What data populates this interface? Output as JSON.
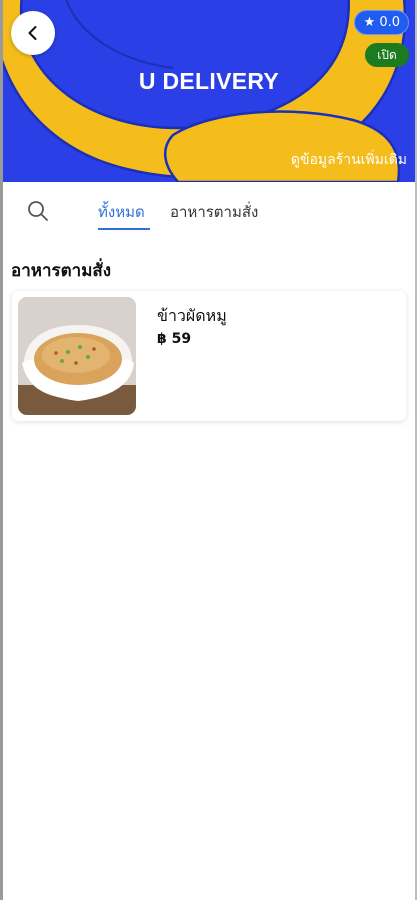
{
  "header": {
    "brand": "U DELIVERY",
    "more_info": "ดูข้อมูลร้านเพิ่มเติม",
    "rating": "0.0",
    "status": "เปิด",
    "colors": {
      "banner": "#2b3fe6",
      "logo_yellow": "#f4bd1c",
      "open_badge": "#1c7a1f"
    }
  },
  "tabs": [
    {
      "label": "ทั้งหมด",
      "active": true
    },
    {
      "label": "อาหารตามสั่ง",
      "active": false
    }
  ],
  "section": {
    "title": "อาหารตามสั่ง"
  },
  "menu_items": [
    {
      "name": "ข้าวผัดหมู",
      "price": "฿ 59"
    }
  ],
  "icons": [
    "back-arrow-icon",
    "star-icon",
    "search-icon"
  ]
}
